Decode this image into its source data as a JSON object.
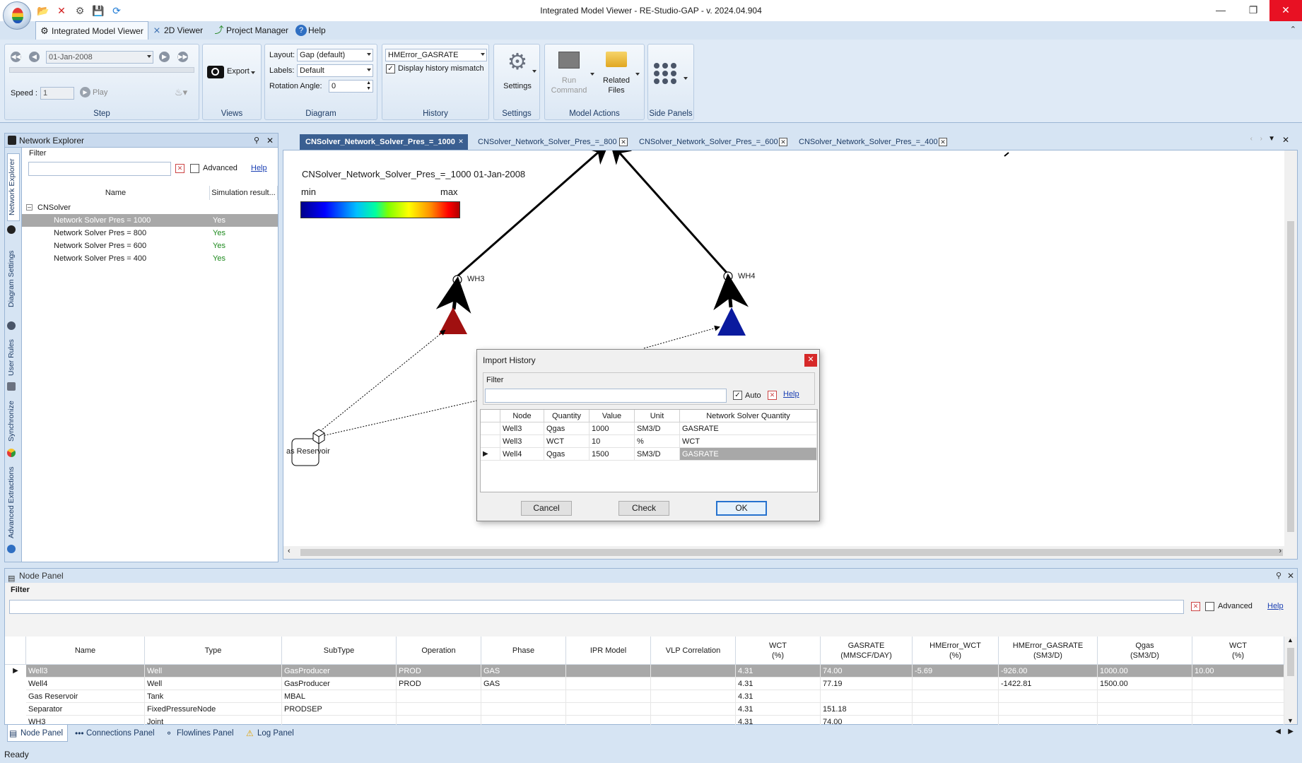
{
  "window": {
    "title": "Integrated Model Viewer - RE-Studio-GAP - v. 2024.04.904"
  },
  "ribbon_tabs": [
    {
      "label": "Integrated Model Viewer",
      "icon": "model-viewer-icon"
    },
    {
      "label": "2D Viewer",
      "icon": "viewer-2d-icon"
    },
    {
      "label": "Project Manager",
      "icon": "project-manager-icon"
    },
    {
      "label": "Help",
      "icon": "help-icon"
    }
  ],
  "ribbon": {
    "step": {
      "date": "01-Jan-2008",
      "speed_label": "Speed :",
      "speed_value": "1",
      "play_label": "Play",
      "group_label": "Step"
    },
    "views": {
      "export_label": "Export",
      "group_label": "Views"
    },
    "diagram": {
      "layout_label": "Layout:",
      "layout_value": "Gap (default)",
      "labels_label": "Labels:",
      "labels_value": "Default",
      "rotation_label": "Rotation Angle:",
      "rotation_value": "0",
      "group_label": "Diagram"
    },
    "history": {
      "variable_value": "HMError_GASRATE",
      "mismatch_label": "Display history mismatch",
      "mismatch_checked": true,
      "group_label": "History"
    },
    "settings": {
      "button_label": "Settings",
      "group_label": "Settings"
    },
    "model_actions": {
      "run_label_1": "Run",
      "run_label_2": "Command",
      "related_label_1": "Related",
      "related_label_2": "Files",
      "group_label": "Model Actions"
    },
    "side_panels": {
      "group_label": "Side Panels"
    }
  },
  "network_explorer": {
    "title": "Network Explorer",
    "filter_label": "Filter",
    "advanced_label": "Advanced",
    "help_label": "Help",
    "columns": [
      "Name",
      "Simulation result..."
    ],
    "root": "CNSolver",
    "items": [
      {
        "name": "Network Solver Pres = 1000",
        "result": "Yes",
        "selected": true
      },
      {
        "name": "Network Solver Pres = 800",
        "result": "Yes",
        "selected": false
      },
      {
        "name": "Network Solver Pres = 600",
        "result": "Yes",
        "selected": false
      },
      {
        "name": "Network Solver Pres = 400",
        "result": "Yes",
        "selected": false
      }
    ],
    "side_tabs": [
      "Network Explorer",
      "Diagram Settings",
      "User Rules",
      "Synchronize",
      "Advanced Extractions"
    ]
  },
  "diagram_tabs": [
    {
      "label": "CNSolver_Network_Solver_Pres_=_1000",
      "active": true
    },
    {
      "label": "CNSolver_Network_Solver_Pres_=_800",
      "active": false
    },
    {
      "label": "CNSolver_Network_Solver_Pres_=_600",
      "active": false
    },
    {
      "label": "CNSolver_Network_Solver_Pres_=_400",
      "active": false
    }
  ],
  "diagram": {
    "title": "CNSolver_Network_Solver_Pres_=_1000  01-Jan-2008",
    "legend_min": "min",
    "legend_max": "max",
    "nodes": {
      "wh3": "WH3",
      "wh4": "WH4",
      "reservoir": "as Reservoir"
    },
    "colors": {
      "well3": "#a01010",
      "well4": "#0a1a9e"
    }
  },
  "dialog": {
    "title": "Import History",
    "filter_label": "Filter",
    "auto_label": "Auto",
    "auto_checked": true,
    "help_label": "Help",
    "columns": [
      "Node",
      "Quantity",
      "Value",
      "Unit",
      "Network Solver Quantity"
    ],
    "rows": [
      {
        "node": "Well3",
        "quantity": "Qgas",
        "value": "1000",
        "unit": "SM3/D",
        "ns_quantity": "GASRATE",
        "current": false
      },
      {
        "node": "Well3",
        "quantity": "WCT",
        "value": "10",
        "unit": "%",
        "ns_quantity": "WCT",
        "current": false
      },
      {
        "node": "Well4",
        "quantity": "Qgas",
        "value": "1500",
        "unit": "SM3/D",
        "ns_quantity": "GASRATE",
        "current": true
      }
    ],
    "buttons": {
      "cancel": "Cancel",
      "check": "Check",
      "ok": "OK"
    }
  },
  "node_panel": {
    "title": "Node Panel",
    "filter_label": "Filter",
    "advanced_label": "Advanced",
    "help_label": "Help",
    "columns": [
      {
        "l1": "Name",
        "l2": ""
      },
      {
        "l1": "Type",
        "l2": ""
      },
      {
        "l1": "SubType",
        "l2": ""
      },
      {
        "l1": "Operation",
        "l2": ""
      },
      {
        "l1": "Phase",
        "l2": ""
      },
      {
        "l1": "IPR Model",
        "l2": ""
      },
      {
        "l1": "VLP Correlation",
        "l2": ""
      },
      {
        "l1": "WCT",
        "l2": "(%)"
      },
      {
        "l1": "GASRATE",
        "l2": "(MMSCF/DAY)"
      },
      {
        "l1": "HMError_WCT",
        "l2": "(%)"
      },
      {
        "l1": "HMError_GASRATE",
        "l2": "(SM3/D)"
      },
      {
        "l1": "Qgas",
        "l2": "(SM3/D)"
      },
      {
        "l1": "WCT",
        "l2": "(%)"
      }
    ],
    "rows": [
      {
        "cells": [
          "Well3",
          "Well",
          "GasProducer",
          "PROD",
          "GAS",
          "",
          "",
          "4.31",
          "74.00",
          "-5.69",
          "-926.00",
          "1000.00",
          "10.00"
        ],
        "selected": true
      },
      {
        "cells": [
          "Well4",
          "Well",
          "GasProducer",
          "PROD",
          "GAS",
          "",
          "",
          "4.31",
          "77.19",
          "",
          "-1422.81",
          "1500.00",
          ""
        ],
        "selected": false
      },
      {
        "cells": [
          "Gas Reservoir",
          "Tank",
          "MBAL",
          "",
          "",
          "",
          "",
          "4.31",
          "",
          "",
          "",
          "",
          ""
        ],
        "selected": false
      },
      {
        "cells": [
          "Separator",
          "FixedPressureNode",
          "PRODSEP",
          "",
          "",
          "",
          "",
          "4.31",
          "151.18",
          "",
          "",
          "",
          ""
        ],
        "selected": false
      },
      {
        "cells": [
          "WH3",
          "Joint",
          "",
          "",
          "",
          "",
          "",
          "4.31",
          "74.00",
          "",
          "",
          "",
          ""
        ],
        "selected": false
      }
    ]
  },
  "bottom_tabs": [
    "Node Panel",
    "Connections Panel",
    "Flowlines Panel",
    "Log Panel"
  ],
  "status": {
    "text": "Ready"
  }
}
